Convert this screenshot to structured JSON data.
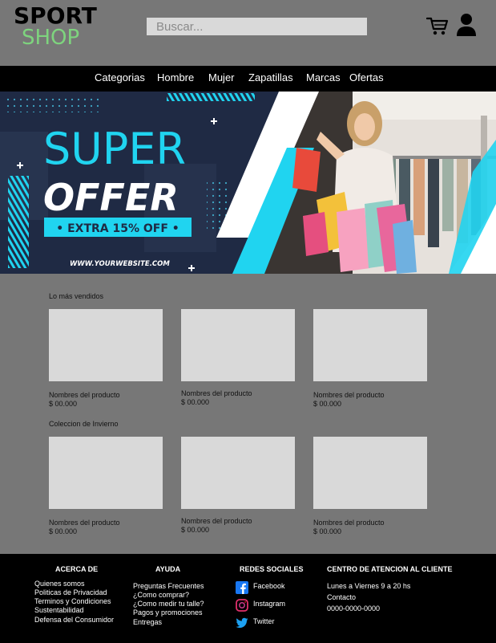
{
  "header": {
    "logo_top": "SPORT",
    "logo_bottom": "SHOP",
    "search_placeholder": "Buscar...",
    "cart_icon": "shopping-cart-icon",
    "user_icon": "user-icon"
  },
  "nav": {
    "items": [
      "Categorias",
      "Hombre",
      "Mujer",
      "Zapatillas",
      "Marcas",
      "Ofertas"
    ]
  },
  "banner": {
    "line1": "SUPER",
    "line2": "OFFER",
    "badge": "• EXTRA 15% OFF •",
    "url": "WWW.YOURWEBSITE.COM",
    "colors": {
      "accent": "#20d4f0",
      "bg": "#1f2a44"
    }
  },
  "sections": [
    {
      "title": "Lo más vendidos",
      "products": [
        {
          "name": "Nombres del producto",
          "price": "$ 00.000"
        },
        {
          "name": "Nombres del producto",
          "price": "$ 00.000"
        },
        {
          "name": "Nombres del producto",
          "price": "$ 00.000"
        }
      ]
    },
    {
      "title": "Coleccion de Invierno",
      "products": [
        {
          "name": "Nombres del producto",
          "price": "$ 00.000"
        },
        {
          "name": "Nombres del producto",
          "price": "$ 00.000"
        },
        {
          "name": "Nombres del producto",
          "price": "$ 00.000"
        }
      ]
    }
  ],
  "footer": {
    "about": {
      "title": "ACERCA DE",
      "links": [
        "Quienes somos",
        "Politicas de Privacidad",
        "Terminos y Condiciones",
        "Sustentabilidad",
        "Defensa del Consumidor"
      ]
    },
    "help": {
      "title": "AYUDA",
      "links": [
        "Preguntas Frecuentes",
        "¿Como  comprar?",
        "¿Como medir tu talle?",
        "Pagos y promociones",
        "Entregas"
      ]
    },
    "social": {
      "title": "REDES SOCIALES",
      "links": [
        "Facebook",
        "Instagram",
        "Twitter"
      ],
      "icons": [
        "facebook-icon",
        "instagram-icon",
        "twitter-icon"
      ]
    },
    "support": {
      "title": "CENTRO DE ATENCION AL CLIENTE",
      "lines": [
        "Lunes a Viernes 9 a 20 hs",
        "Contacto",
        "0000-0000-0000"
      ]
    }
  }
}
